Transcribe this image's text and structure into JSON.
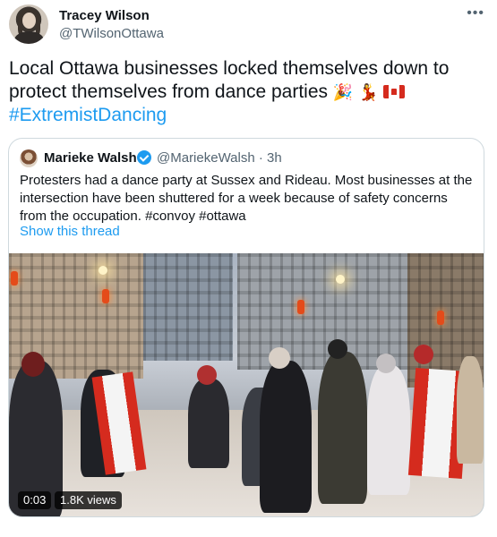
{
  "tweet": {
    "author": {
      "name": "Tracey Wilson",
      "handle": "@TWilsonOttawa"
    },
    "text": "Local Ottawa businesses locked themselves down to protect themselves from dance parties",
    "emojis": [
      "🎉",
      "💃"
    ],
    "hashtag": "#ExtremistDancing"
  },
  "quote": {
    "author": {
      "name": "Marieke Walsh",
      "handle": "@MariekeWalsh · 3h"
    },
    "text": "Protesters had a dance party at Sussex and Rideau. Most businesses at the intersection have been shuttered for a week because of safety concerns from the occupation. #convoy #ottawa",
    "show_thread": "Show this thread",
    "video": {
      "duration": "0:03",
      "views": "1.8K views"
    }
  },
  "icons": {
    "more": "more-horizontal-icon",
    "verified": "verified-badge-icon",
    "flag": "canada-flag-icon"
  },
  "colors": {
    "accent": "#1d9bf0",
    "secondary_text": "#536471",
    "border": "#cfd9de"
  }
}
